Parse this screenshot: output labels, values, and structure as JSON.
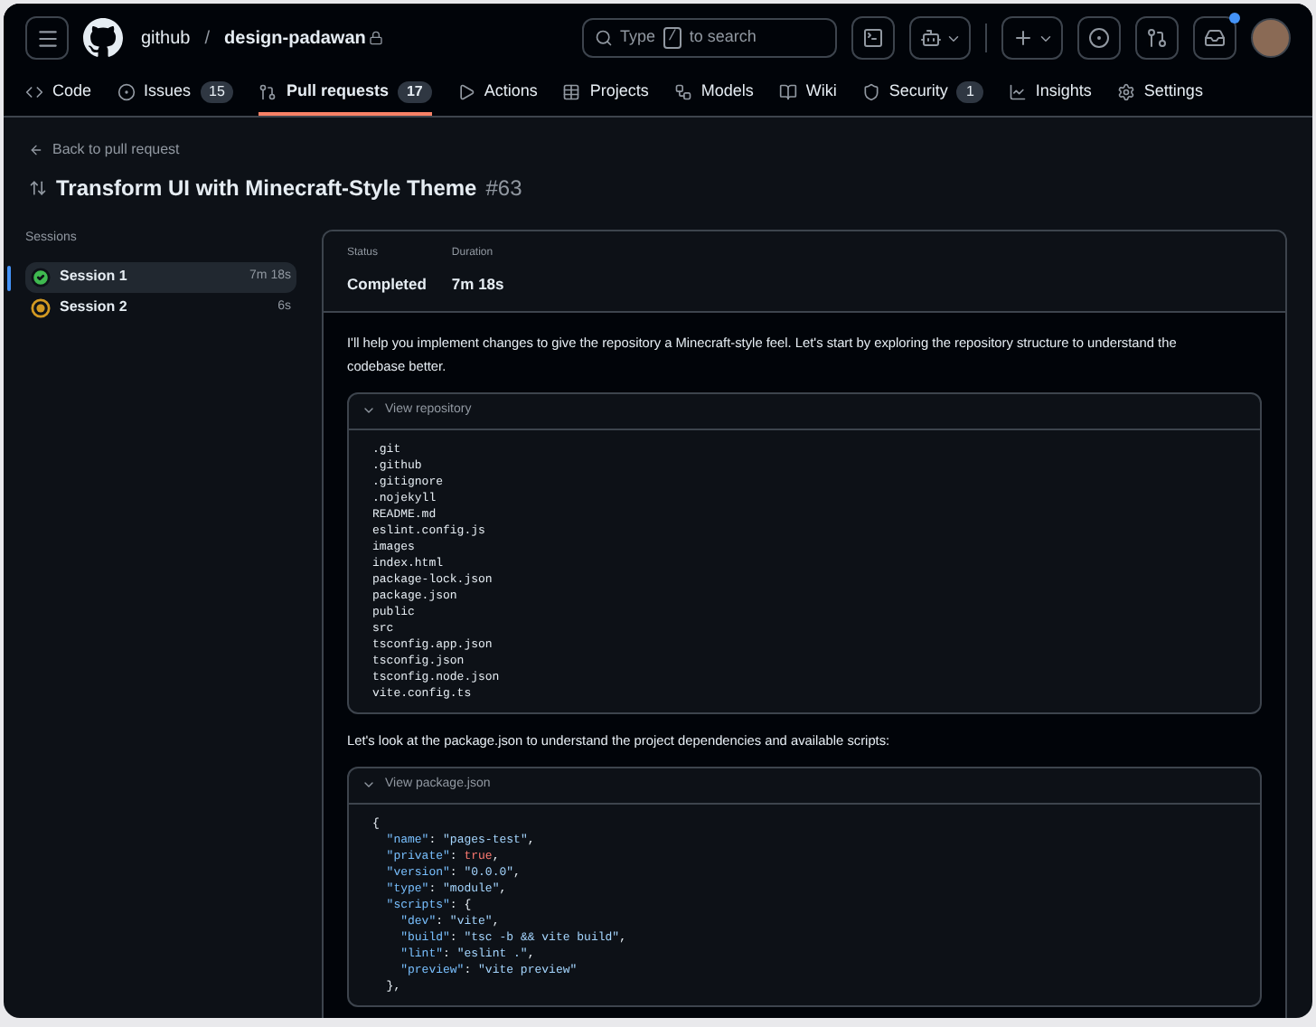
{
  "header": {
    "owner": "github",
    "separator": "/",
    "repo": "design-padawan",
    "search": {
      "placeholder_before": "Type",
      "key": "/",
      "placeholder_after": "to search"
    },
    "inbox_unread": true
  },
  "nav": [
    {
      "label": "Code",
      "selected": false
    },
    {
      "label": "Issues",
      "count": "15",
      "selected": false
    },
    {
      "label": "Pull requests",
      "count": "17",
      "selected": true
    },
    {
      "label": "Actions",
      "selected": false
    },
    {
      "label": "Projects",
      "selected": false
    },
    {
      "label": "Models",
      "selected": false
    },
    {
      "label": "Wiki",
      "selected": false
    },
    {
      "label": "Security",
      "count": "1",
      "selected": false
    },
    {
      "label": "Insights",
      "selected": false
    },
    {
      "label": "Settings",
      "selected": false
    }
  ],
  "back_link": "Back to pull request",
  "title": "Transform UI with Minecraft-Style Theme",
  "number": "#63",
  "sessions": {
    "heading": "Sessions",
    "items": [
      {
        "name": "Session 1",
        "duration": "7m 18s",
        "kind": "completed",
        "selected": true
      },
      {
        "name": "Session 2",
        "duration": "6s",
        "kind": "running",
        "selected": false
      }
    ]
  },
  "summary": [
    {
      "label": "Status",
      "value": "Completed"
    },
    {
      "label": "Duration",
      "value": "7m 18s"
    }
  ],
  "log": [
    {
      "kind": "text",
      "text": "I'll help you implement changes to give the repository a Minecraft-style feel. Let's start by exploring the repository structure to understand the codebase better."
    },
    {
      "kind": "block",
      "title": "View repository",
      "expanded": true,
      "lines": [
        [
          {
            "text": ".git",
            "kind": "plain"
          }
        ],
        [
          {
            "text": ".github",
            "kind": "plain"
          }
        ],
        [
          {
            "text": ".gitignore",
            "kind": "plain"
          }
        ],
        [
          {
            "text": ".nojekyll",
            "kind": "plain"
          }
        ],
        [
          {
            "text": "README.md",
            "kind": "plain"
          }
        ],
        [
          {
            "text": "eslint.config.js",
            "kind": "plain"
          }
        ],
        [
          {
            "text": "images",
            "kind": "plain"
          }
        ],
        [
          {
            "text": "index.html",
            "kind": "plain"
          }
        ],
        [
          {
            "text": "package-lock.json",
            "kind": "plain"
          }
        ],
        [
          {
            "text": "package.json",
            "kind": "plain"
          }
        ],
        [
          {
            "text": "public",
            "kind": "plain"
          }
        ],
        [
          {
            "text": "src",
            "kind": "plain"
          }
        ],
        [
          {
            "text": "tsconfig.app.json",
            "kind": "plain"
          }
        ],
        [
          {
            "text": "tsconfig.json",
            "kind": "plain"
          }
        ],
        [
          {
            "text": "tsconfig.node.json",
            "kind": "plain"
          }
        ],
        [
          {
            "text": "vite.config.ts",
            "kind": "plain"
          }
        ]
      ]
    },
    {
      "kind": "text",
      "text": "Let's look at the package.json to understand the project dependencies and available scripts:"
    },
    {
      "kind": "block",
      "title": "View package.json",
      "expanded": true,
      "lines": [
        [
          {
            "text": "{",
            "kind": "plain"
          }
        ],
        [
          {
            "text": "  \"name\"",
            "kind": "key"
          },
          {
            "text": ": ",
            "kind": "plain"
          },
          {
            "text": "\"pages-test\"",
            "kind": "string"
          },
          {
            "text": ",",
            "kind": "plain"
          }
        ],
        [
          {
            "text": "  \"private\"",
            "kind": "key"
          },
          {
            "text": ": ",
            "kind": "plain"
          },
          {
            "text": "true",
            "kind": "literal"
          },
          {
            "text": ",",
            "kind": "plain"
          }
        ],
        [
          {
            "text": "  \"version\"",
            "kind": "key"
          },
          {
            "text": ": ",
            "kind": "plain"
          },
          {
            "text": "\"0.0.0\"",
            "kind": "string"
          },
          {
            "text": ",",
            "kind": "plain"
          }
        ],
        [
          {
            "text": "  \"type\"",
            "kind": "key"
          },
          {
            "text": ": ",
            "kind": "plain"
          },
          {
            "text": "\"module\"",
            "kind": "string"
          },
          {
            "text": ",",
            "kind": "plain"
          }
        ],
        [
          {
            "text": "  \"scripts\"",
            "kind": "key"
          },
          {
            "text": ": {",
            "kind": "plain"
          }
        ],
        [
          {
            "text": "    \"dev\"",
            "kind": "key"
          },
          {
            "text": ": ",
            "kind": "plain"
          },
          {
            "text": "\"vite\"",
            "kind": "string"
          },
          {
            "text": ",",
            "kind": "plain"
          }
        ],
        [
          {
            "text": "    \"build\"",
            "kind": "key"
          },
          {
            "text": ": ",
            "kind": "plain"
          },
          {
            "text": "\"tsc -b && vite build\"",
            "kind": "string"
          },
          {
            "text": ",",
            "kind": "plain"
          }
        ],
        [
          {
            "text": "    \"lint\"",
            "kind": "key"
          },
          {
            "text": ": ",
            "kind": "plain"
          },
          {
            "text": "\"eslint .\"",
            "kind": "string"
          },
          {
            "text": ",",
            "kind": "plain"
          }
        ],
        [
          {
            "text": "    \"preview\"",
            "kind": "key"
          },
          {
            "text": ": ",
            "kind": "plain"
          },
          {
            "text": "\"vite preview\"",
            "kind": "string"
          }
        ],
        [
          {
            "text": "  },",
            "kind": "plain"
          }
        ]
      ]
    }
  ]
}
